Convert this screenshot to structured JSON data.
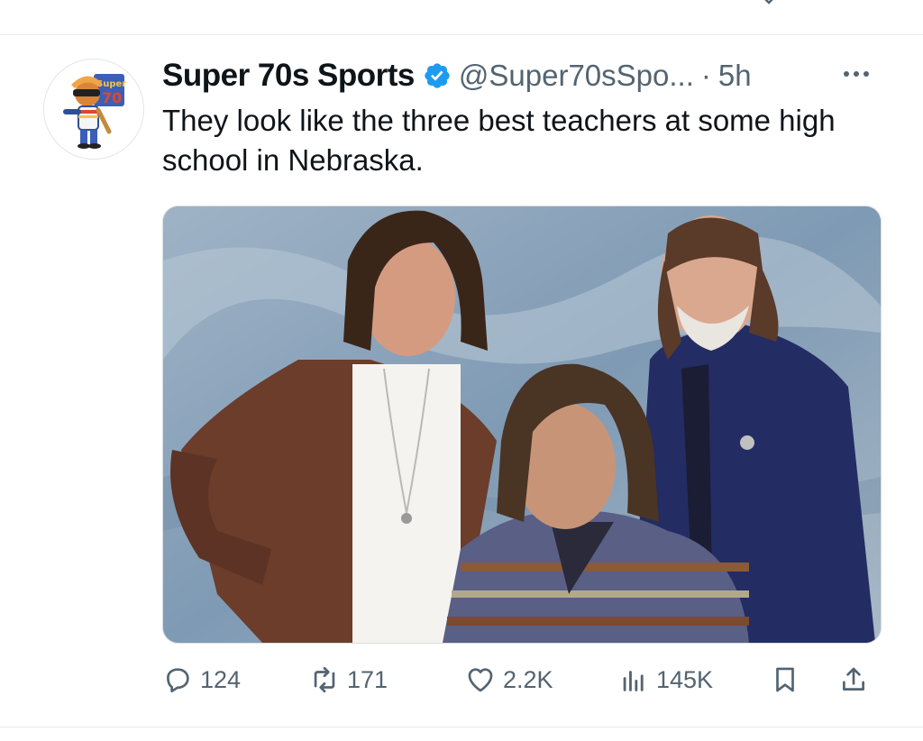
{
  "tweet": {
    "author_name": "Super 70s Sports",
    "handle": "@Super70sSpo...",
    "separator": "·",
    "time": "5h",
    "text": "They look like the three best teachers at some high school in Nebraska.",
    "avatar_icon": "super-70s-sports-logo",
    "verified_icon": "verified-badge-icon",
    "accent_color": "#1d9bf0"
  },
  "actions": {
    "replies": "124",
    "reposts": "171",
    "likes": "2.2K",
    "views": "145K"
  },
  "media": {
    "description_icon": "photo-three-men"
  }
}
